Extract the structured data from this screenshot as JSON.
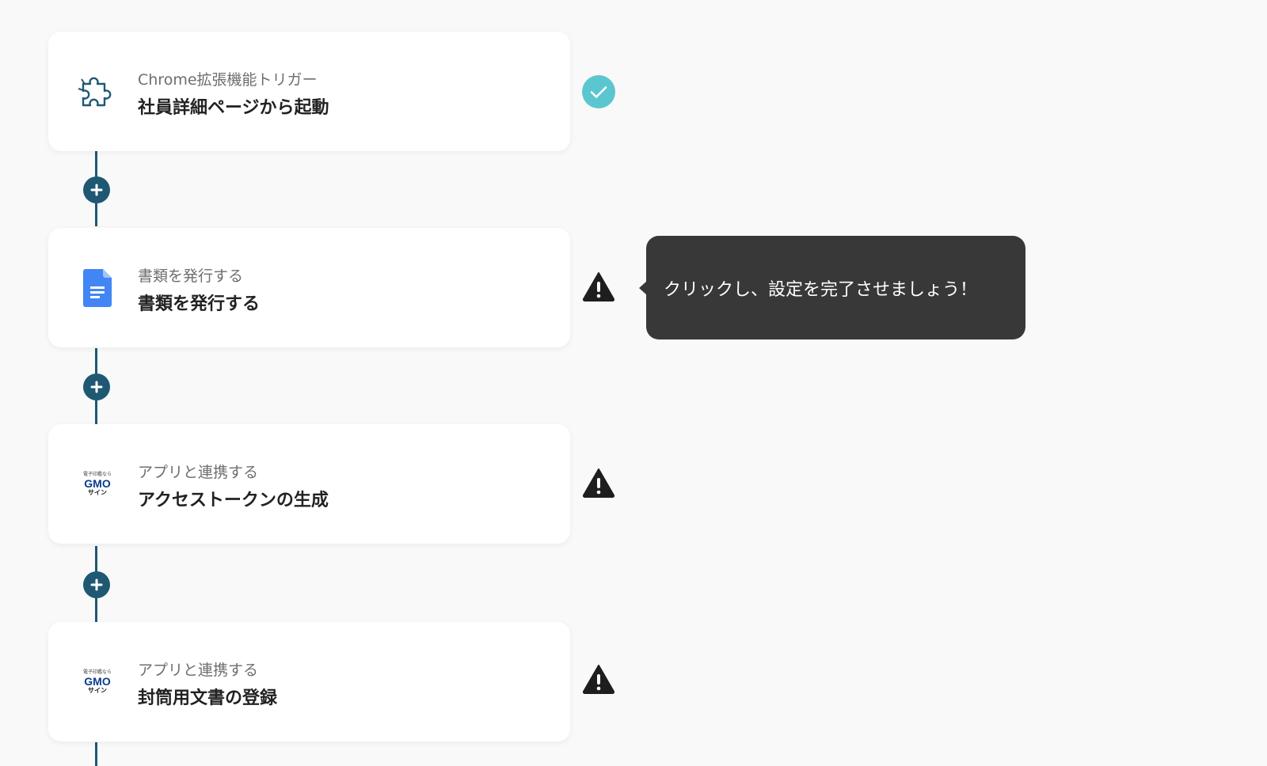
{
  "steps": [
    {
      "icon": "puzzle-icon",
      "subtitle": "Chrome拡張機能トリガー",
      "title": "社員詳細ページから起動",
      "status": "complete"
    },
    {
      "icon": "google-docs-icon",
      "subtitle": "書類を発行する",
      "title": "書類を発行する",
      "status": "warning"
    },
    {
      "icon": "gmo-sign-logo",
      "logo_text": [
        "電子印鑑なら",
        "GMO",
        "サイン"
      ],
      "subtitle": "アプリと連携する",
      "title": "アクセストークンの生成",
      "status": "warning"
    },
    {
      "icon": "gmo-sign-logo",
      "logo_text": [
        "電子印鑑なら",
        "GMO",
        "サイン"
      ],
      "subtitle": "アプリと連携する",
      "title": "封筒用文書の登録",
      "status": "warning"
    }
  ],
  "tooltip": {
    "text": "クリックし、設定を完了させましょう！"
  },
  "colors": {
    "connector": "#1f5873",
    "complete": "#5cc6d0",
    "warning": "#1e1e1e",
    "tooltip_bg": "#383838",
    "docs_blue": "#4285f4"
  }
}
